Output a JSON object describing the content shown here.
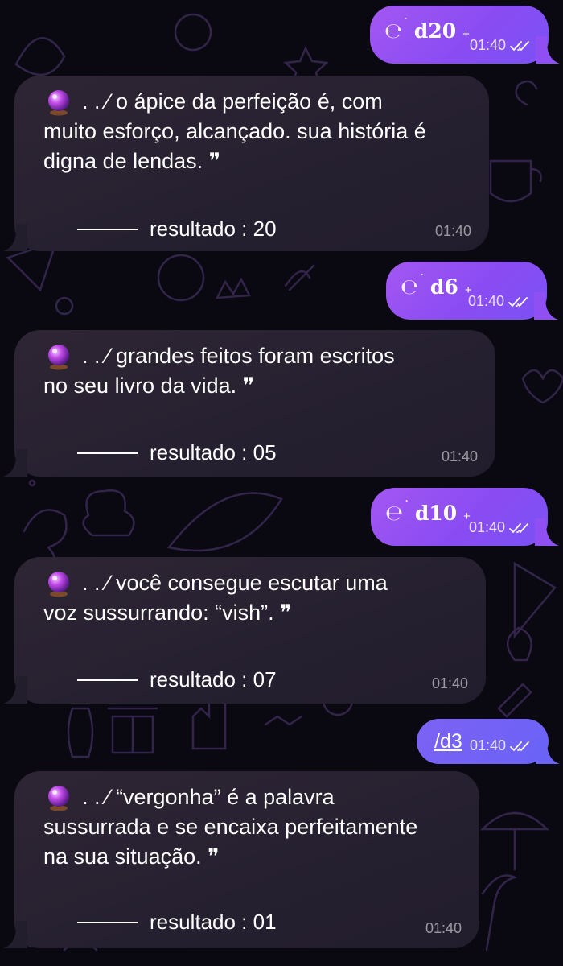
{
  "theme": {
    "sent_color": "#8f4ff3",
    "sent_color_alt": "#6b62f6",
    "received_color": "#2a2231",
    "background": "#0a0810",
    "doodle_color": "#3a2a55"
  },
  "messages": [
    {
      "direction": "outgoing",
      "command": "d20",
      "plus": "+",
      "time": "01:40",
      "status_icon": "double-check-icon"
    },
    {
      "direction": "incoming",
      "icon": "crystal-ball-icon",
      "first_line": ". . ⁄ o ápice da perfeição é, com",
      "rest_lines": [
        "muito esforço, alcançado. sua história é",
        "digna de lendas. ❞"
      ],
      "result": "resultado : 20",
      "time": "01:40"
    },
    {
      "direction": "outgoing",
      "command": "d6",
      "plus": "+",
      "time": "01:40",
      "status_icon": "double-check-icon"
    },
    {
      "direction": "incoming",
      "icon": "crystal-ball-icon",
      "first_line": ". . ⁄ grandes feitos foram escritos",
      "rest_lines": [
        "no seu livro da vida. ❞"
      ],
      "result": "resultado : 05",
      "time": "01:40"
    },
    {
      "direction": "outgoing",
      "command": "d10",
      "plus": "+",
      "time": "01:40",
      "status_icon": "double-check-icon"
    },
    {
      "direction": "incoming",
      "icon": "crystal-ball-icon",
      "first_line": ". . ⁄ você consegue escutar uma",
      "rest_lines": [
        "voz sussurrando: “vish”. ❞"
      ],
      "result": "resultado : 07",
      "time": "01:40"
    },
    {
      "direction": "outgoing",
      "command_link": "/d3",
      "time": "01:40",
      "status_icon": "double-check-icon"
    },
    {
      "direction": "incoming",
      "icon": "crystal-ball-icon",
      "first_line": ". . ⁄ “vergonha” é a palavra",
      "rest_lines": [
        "sussurrada e se encaixa perfeitamente",
        "na sua situação. ❞"
      ],
      "result": "resultado : 01",
      "time": "01:40"
    }
  ]
}
